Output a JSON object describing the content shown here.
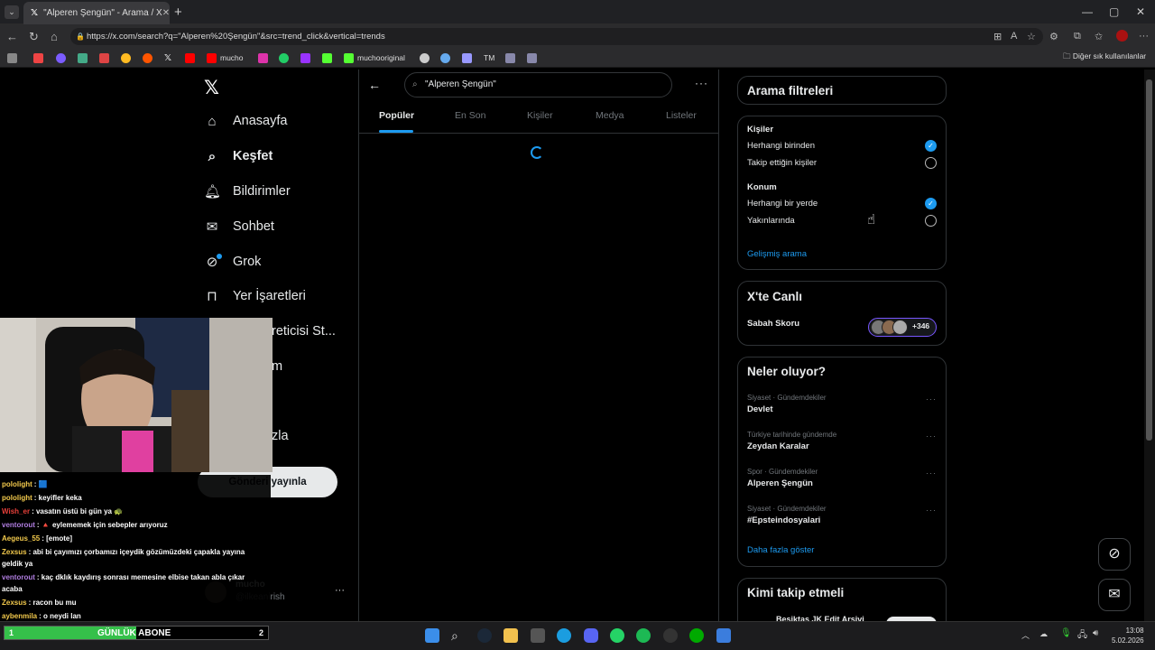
{
  "browser": {
    "tab_title": "\"Alperen Şengün\" - Arama / X",
    "tab_close": "✕",
    "new_tab": "+",
    "url": "https://x.com/search?q=\"Alperen%20Şengün\"&src=trend_click&vertical=trends",
    "bookmarks": [
      "mucho",
      "muchooriginal",
      "TM"
    ],
    "other_bookmarks": "Diğer sık kullanılanlar",
    "window_controls": [
      "—",
      "▢",
      "✕"
    ]
  },
  "nav": {
    "logo": "𝕏",
    "items": [
      {
        "label": "Anasayfa",
        "icon": "home-icon",
        "glyph": "⌂"
      },
      {
        "label": "Keşfet",
        "icon": "search-icon",
        "glyph": "⌕"
      },
      {
        "label": "Bildirimler",
        "icon": "bell-icon",
        "glyph": "♫"
      },
      {
        "label": "Sohbet",
        "icon": "mail-icon",
        "glyph": "✉"
      },
      {
        "label": "Grok",
        "icon": "grok-icon",
        "glyph": "⊘"
      },
      {
        "label": "Yer İşaretleri",
        "icon": "bookmark-icon",
        "glyph": "⊓"
      },
      {
        "label": "reticisi St...",
        "icon": "creator-studio-icon",
        "glyph": ""
      },
      {
        "label": "m",
        "icon": "premium-icon",
        "glyph": ""
      },
      {
        "label": "zla",
        "icon": "more-icon",
        "glyph": ""
      }
    ],
    "post_button": "Gönderi yayınla",
    "profile_name": "mucho",
    "profile_handle": "@ilkeanirish",
    "profile_more": "···"
  },
  "search": {
    "query": "\"Alperen Şengün\"",
    "more": "···",
    "tabs": [
      "Popüler",
      "En Son",
      "Kişiler",
      "Medya",
      "Listeler"
    ],
    "active_tab": "Popüler"
  },
  "filters": {
    "title": "Arama filtreleri",
    "people_heading": "Kişiler",
    "people_options": [
      {
        "label": "Herhangi birinden",
        "selected": true
      },
      {
        "label": "Takip ettiğin kişiler",
        "selected": false
      }
    ],
    "location_heading": "Konum",
    "location_options": [
      {
        "label": "Herhangi bir yerde",
        "selected": true
      },
      {
        "label": "Yakınlarında",
        "selected": false
      }
    ],
    "advanced_link": "Gelişmiş arama"
  },
  "live": {
    "title": "X'te Canlı",
    "space_name": "Sabah Skoru",
    "listener_count": "+346"
  },
  "trends": {
    "title": "Neler oluyor?",
    "items": [
      {
        "category": "Siyaset · Gündemdekiler",
        "title": "Devlet"
      },
      {
        "category": "Türkiye tarihinde gündemde",
        "title": "Zeydan Karalar"
      },
      {
        "category": "Spor · Gündemdekiler",
        "title": "Alperen Şengün"
      },
      {
        "category": "Siyaset · Gündemdekiler",
        "title": "#Epsteindosyalari"
      }
    ],
    "more_link": "Daha fazla göster",
    "item_more": "···"
  },
  "who_to_follow": {
    "title": "Kimi takip etmeli",
    "first_name": "Beşiktaş JK Edit Arşivi"
  },
  "chat": [
    {
      "user": "pololight",
      "color": "#f2c94c",
      "text": ": 🟦"
    },
    {
      "user": "pololight",
      "color": "#f2c94c",
      "text": ": keyifler keka"
    },
    {
      "user": "Wish_er",
      "color": "#e8403a",
      "text": ": vasatın üstü bi gün ya 🐢"
    },
    {
      "user": "ventorout",
      "color": "#b07de0",
      "text": ":  🔺 eylememek için sebepler arıyoruz"
    },
    {
      "user": "Aegeus_55",
      "color": "#f2c94c",
      "text": ": [emote]"
    },
    {
      "user": "Zexsus",
      "color": "#f2c94c",
      "text": ": abi bi çayımızı çorbamızı içeydik gözümüzdeki çapakla yayına"
    },
    {
      "user": "",
      "color": "#fff",
      "text": "geldik ya"
    },
    {
      "user": "ventorout",
      "color": "#b07de0",
      "text": ": kaç dklık kaydırış sonrası memesine elbise takan abla çıkar"
    },
    {
      "user": "",
      "color": "#fff",
      "text": "acaba"
    },
    {
      "user": "Zexsus",
      "color": "#f2c94c",
      "text": ": racon bu mu"
    },
    {
      "user": "aybenmila",
      "color": "#f2c94c",
      "text": ": o neydi lan"
    }
  ],
  "sub_goal": {
    "start": "1",
    "label": "GÜNLÜK ABONE",
    "end": "2",
    "progress_fraction": 0.5
  },
  "taskbar": {
    "time": "13:08",
    "date": "5.02.2026"
  },
  "colors": {
    "accent": "#1d9bf0",
    "background": "#000000",
    "border": "#2f3336",
    "muted_text": "#71767b",
    "live_border": "#7856ff",
    "sub_fill": "#35c04a"
  }
}
